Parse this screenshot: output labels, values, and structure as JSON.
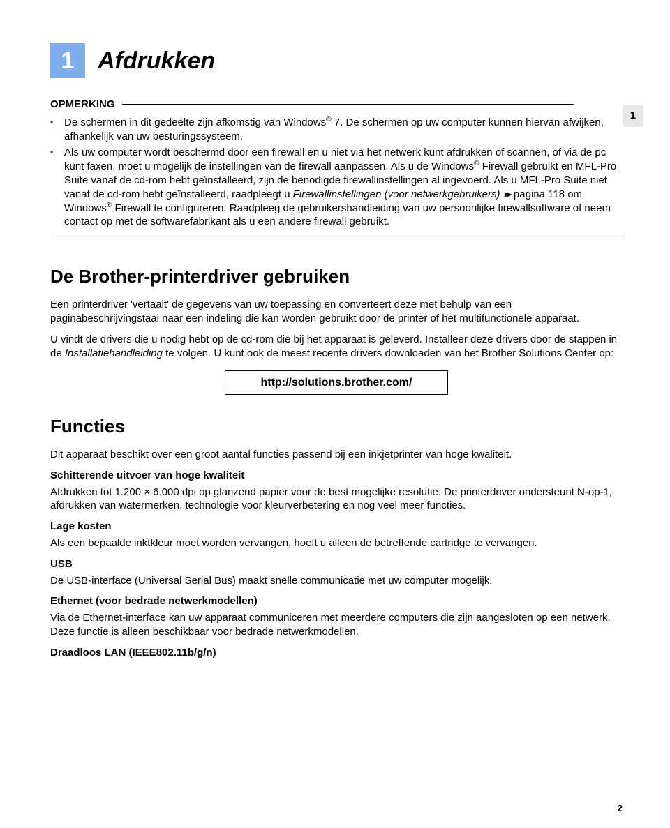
{
  "chapter": {
    "number": "1",
    "title": "Afdrukken"
  },
  "side_marker": "1",
  "note": {
    "label": "OPMERKING",
    "bullets": [
      {
        "pre": "De schermen in dit gedeelte zijn afkomstig van Windows",
        "sup": "®",
        "post": " 7. De schermen op uw computer kunnen hiervan afwijken, afhankelijk van uw besturingssysteem."
      },
      {
        "p1": "Als uw computer wordt beschermd door een firewall en u niet via het netwerk kunt afdrukken of scannen, of via de pc kunt faxen, moet u mogelijk de instellingen van de firewall aanpassen. Als u de Windows",
        "sup1": "®",
        "p2": " Firewall gebruikt en MFL-Pro Suite vanaf de cd-rom hebt geïnstalleerd, zijn de benodigde firewallinstellingen al ingevoerd. Als u MFL-Pro Suite niet vanaf de cd-rom hebt geïnstalleerd, raadpleegt u ",
        "link": "Firewallinstellingen (voor netwerkgebruikers)",
        "p3_pre": " pagina 118 om Windows",
        "sup2": "®",
        "p3_post": " Firewall te configureren. Raadpleeg de gebruikershandleiding van uw persoonlijke firewallsoftware of neem contact op met de softwarefabrikant als u een andere firewall gebruikt."
      }
    ]
  },
  "section1": {
    "title": "De Brother-printerdriver gebruiken",
    "p1": "Een printerdriver 'vertaalt' de gegevens van uw toepassing en converteert deze met behulp van een paginabeschrijvingstaal naar een indeling die kan worden gebruikt door de printer of het multifunctionele apparaat.",
    "p2a": "U vindt de drivers die u nodig hebt op de cd-rom die bij het apparaat is geleverd. Installeer deze drivers door de stappen in de ",
    "p2_link": "Installatiehandleiding",
    "p2b": " te volgen. U kunt ook de meest recente drivers downloaden van het Brother Solutions Center op:",
    "url": "http://solutions.brother.com/"
  },
  "section2": {
    "title": "Functies",
    "intro": "Dit apparaat beschikt over een groot aantal functies passend bij een inkjetprinter van hoge kwaliteit.",
    "features": [
      {
        "h": "Schitterende uitvoer van hoge kwaliteit",
        "body": "Afdrukken tot 1.200 × 6.000 dpi op glanzend papier voor de best mogelijke resolutie. De printerdriver ondersteunt N-op-1, afdrukken van watermerken, technologie voor kleurverbetering en nog veel meer functies."
      },
      {
        "h": "Lage kosten",
        "body": "Als een bepaalde inktkleur moet worden vervangen, hoeft u alleen de betreffende cartridge te vervangen."
      },
      {
        "h": "USB",
        "body": "De USB-interface (Universal Serial Bus) maakt snelle communicatie met uw computer mogelijk."
      },
      {
        "h": "Ethernet (voor bedrade netwerkmodellen)",
        "body": "Via de Ethernet-interface kan uw apparaat communiceren met meerdere computers die zijn aangesloten op een netwerk. Deze functie is alleen beschikbaar voor bedrade netwerkmodellen."
      },
      {
        "h": "Draadloos LAN (IEEE802.11b/g/n)",
        "body": ""
      }
    ]
  },
  "page_number": "2"
}
